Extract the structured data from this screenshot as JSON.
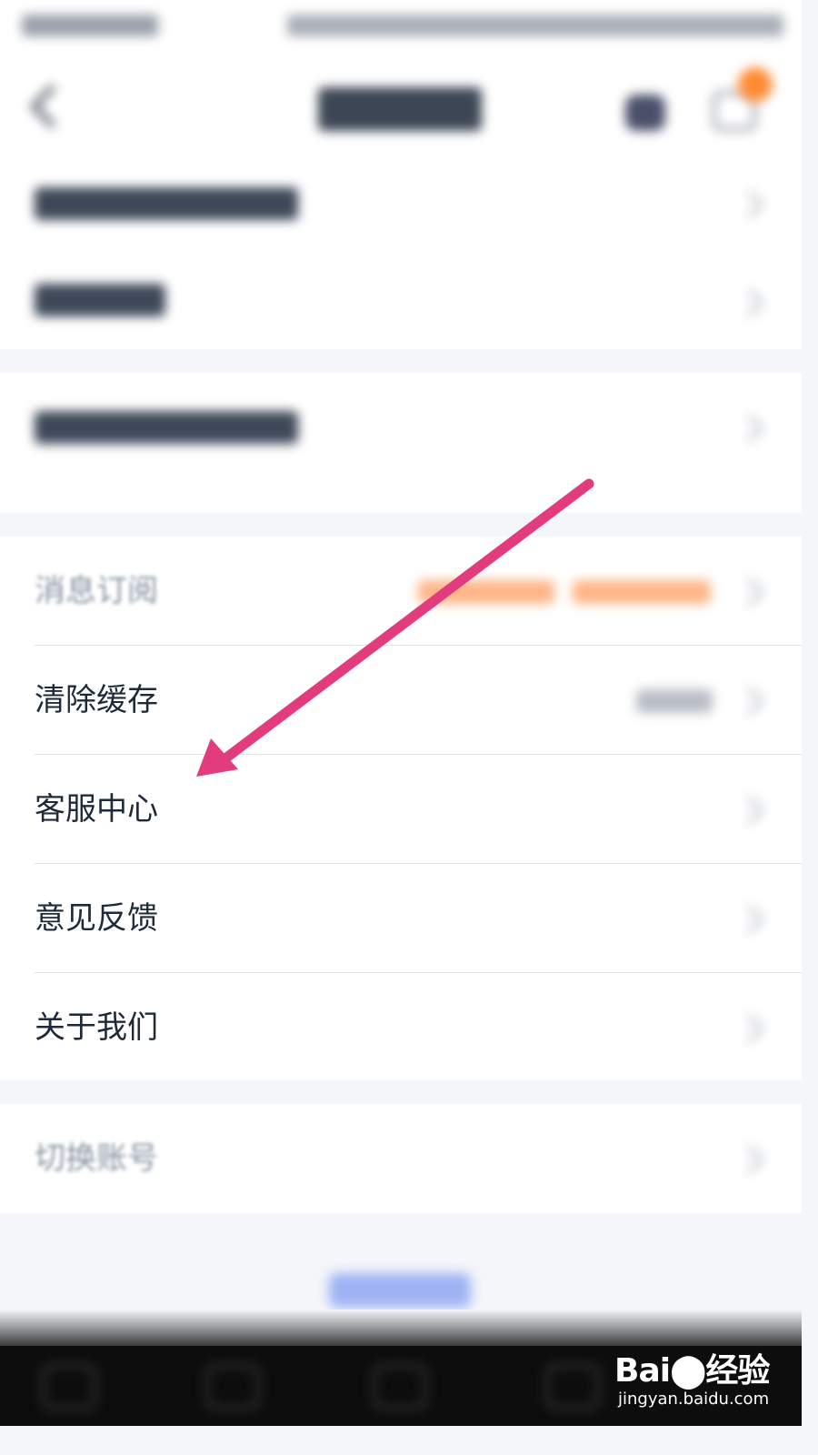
{
  "nav": {
    "title": "账户设置"
  },
  "rows": [
    {
      "label": "消息订阅"
    },
    {
      "label": "清除缓存"
    },
    {
      "label": "客服中心"
    },
    {
      "label": "意见反馈"
    },
    {
      "label": "关于我们"
    },
    {
      "label": "切换账号"
    }
  ],
  "watermark": {
    "brand": "Bai⬤经验",
    "url": "jingyan.baidu.com"
  },
  "colors": {
    "accent_arrow": "#e23c7e",
    "badge": "#ff8a33",
    "link": "#9fb3f4"
  },
  "icons": {
    "back": "back-icon",
    "service": "customer-service-icon",
    "message": "message-icon",
    "chevron": "chevron-right-icon"
  }
}
